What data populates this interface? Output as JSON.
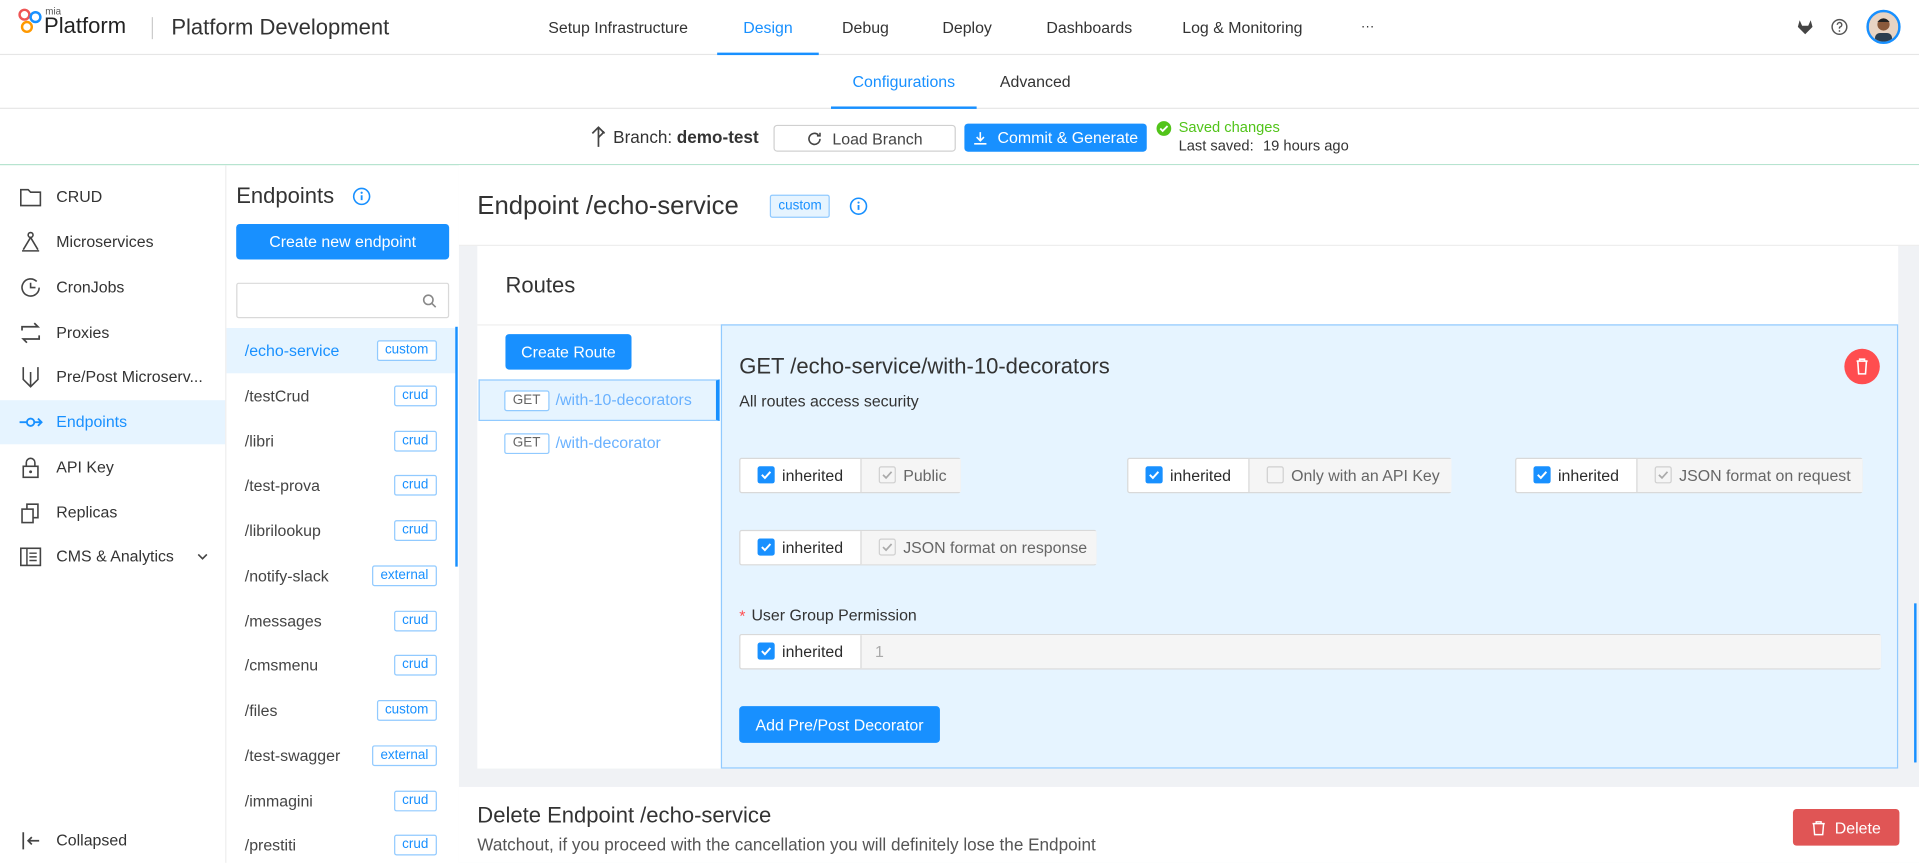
{
  "app": {
    "brand_small": "mia",
    "brand": "Platform",
    "project": "Platform Development"
  },
  "nav": {
    "items": [
      "Setup Infrastructure",
      "Design",
      "Debug",
      "Deploy",
      "Dashboards",
      "Log & Monitoring",
      "···"
    ],
    "active": "Design"
  },
  "subnav": {
    "items": [
      "Configurations",
      "Advanced"
    ],
    "active": "Configurations"
  },
  "branch": {
    "label": "Branch:",
    "name": "demo-test",
    "load_label": "Load Branch",
    "commit_label": "Commit & Generate",
    "saved_status": "Saved changes",
    "last_saved_label": "Last saved:",
    "last_saved_value": "19 hours ago"
  },
  "sidebar": {
    "items": [
      {
        "label": "CRUD",
        "icon": "folder-icon"
      },
      {
        "label": "Microservices",
        "icon": "microservice-icon"
      },
      {
        "label": "CronJobs",
        "icon": "clock-icon"
      },
      {
        "label": "Proxies",
        "icon": "swap-icon"
      },
      {
        "label": "Pre/Post Microserv...",
        "icon": "decorator-icon"
      },
      {
        "label": "Endpoints",
        "icon": "endpoint-icon"
      },
      {
        "label": "API Key",
        "icon": "lock-icon"
      },
      {
        "label": "Replicas",
        "icon": "copy-icon"
      },
      {
        "label": "CMS & Analytics",
        "icon": "cms-icon"
      }
    ],
    "active": "Endpoints",
    "collapse_label": "Collapsed"
  },
  "endpoints": {
    "title": "Endpoints",
    "create_label": "Create new endpoint",
    "search_placeholder": "",
    "items": [
      {
        "path": "/echo-service",
        "tag": "custom"
      },
      {
        "path": "/testCrud",
        "tag": "crud"
      },
      {
        "path": "/libri",
        "tag": "crud"
      },
      {
        "path": "/test-prova",
        "tag": "crud"
      },
      {
        "path": "/librilookup",
        "tag": "crud"
      },
      {
        "path": "/notify-slack",
        "tag": "external"
      },
      {
        "path": "/messages",
        "tag": "crud"
      },
      {
        "path": "/cmsmenu",
        "tag": "crud"
      },
      {
        "path": "/files",
        "tag": "custom"
      },
      {
        "path": "/test-swagger",
        "tag": "external"
      },
      {
        "path": "/immagini",
        "tag": "crud"
      },
      {
        "path": "/prestiti",
        "tag": "crud"
      }
    ]
  },
  "main": {
    "title": "Endpoint /echo-service",
    "title_tag": "custom",
    "routes_title": "Routes",
    "create_route_label": "Create Route",
    "routes": [
      {
        "method": "GET",
        "path": "/with-10-decorators"
      },
      {
        "method": "GET",
        "path": "/with-decorator"
      }
    ],
    "route_detail": {
      "title": "GET /echo-service/with-10-decorators",
      "subtitle": "All routes access security",
      "inherited_label": "inherited",
      "options": [
        "Public",
        "Only with an API Key",
        "JSON format on request",
        "JSON format on response"
      ],
      "permission_label": "User Group Permission",
      "permission_value": "1",
      "add_decorator_label": "Add Pre/Post Decorator"
    },
    "delete": {
      "title": "Delete Endpoint /echo-service",
      "description": "Watchout, if you proceed with the cancellation you will definitely lose the Endpoint",
      "button_label": "Delete"
    }
  },
  "colors": {
    "accent": "#1890ff",
    "danger": "#f5222d",
    "success": "#52c41a",
    "route_bg": "#e6f4ff"
  }
}
